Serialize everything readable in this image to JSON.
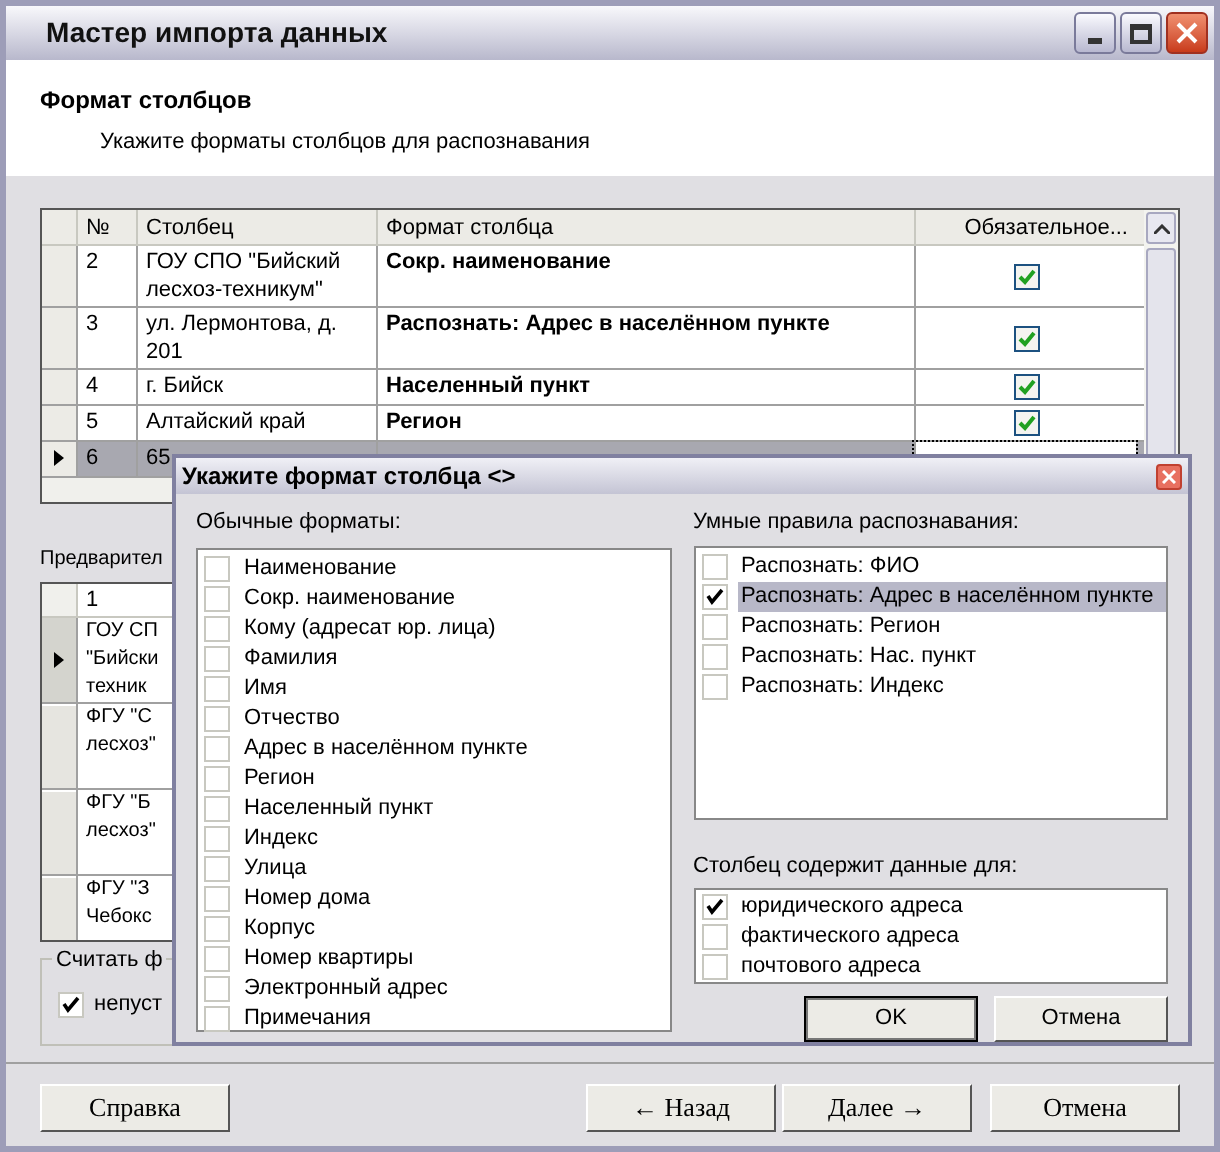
{
  "window": {
    "title": "Мастер импорта данных"
  },
  "header": {
    "title": "Формат столбцов",
    "subtitle": "Укажите форматы столбцов для распознавания"
  },
  "columns_grid": {
    "columns": [
      "№",
      "Столбец",
      "Формат столбца",
      "Обязательное..."
    ],
    "rows": [
      {
        "number": "2",
        "column": "ГОУ СПО \"Бийский лесхоз-техникум\"",
        "format": "Сокр. наименование",
        "required": true,
        "selected": false
      },
      {
        "number": "3",
        "column": "ул. Лермонтова, д. 201",
        "format": "Распознать: Адрес в населённом пункте",
        "required": true,
        "selected": false
      },
      {
        "number": "4",
        "column": "г. Бийск",
        "format": "Населенный пункт",
        "required": true,
        "selected": false
      },
      {
        "number": "5",
        "column": "Алтайский край",
        "format": "Регион",
        "required": true,
        "selected": false
      },
      {
        "number": "6",
        "column": "65",
        "selected": true
      }
    ]
  },
  "preview": {
    "label": "Предварител",
    "columns": [
      "1"
    ],
    "rows": [
      {
        "lines": [
          "ГОУ СП",
          "\"Бийски",
          "техник"
        ],
        "selected": true
      },
      {
        "lines": [
          "ФГУ \"С",
          "лесхоз\""
        ],
        "selected": false
      },
      {
        "lines": [
          "ФГУ \"Б",
          "лесхоз\""
        ],
        "selected": false
      },
      {
        "lines": [
          "ФГУ \"З",
          "Чебокс"
        ],
        "selected": false
      }
    ]
  },
  "count_group": {
    "label": "Считать ф",
    "checkbox": {
      "label": "непуст",
      "checked": true
    }
  },
  "buttons": [
    {
      "label": "Справка",
      "kind": "left"
    },
    {
      "label": "← Назад",
      "kind": "right"
    },
    {
      "label": "Далее →",
      "kind": "right"
    },
    {
      "label": "Отмена",
      "kind": "cancel"
    }
  ],
  "dialog": {
    "title": "Укажите формат столбца <>",
    "standard_label": "Обычные форматы:",
    "standard_formats": [
      {
        "label": "Наименование",
        "checked": false
      },
      {
        "label": "Сокр. наименование",
        "checked": false
      },
      {
        "label": "Кому (адресат юр. лица)",
        "checked": false
      },
      {
        "label": "Фамилия",
        "checked": false
      },
      {
        "label": "Имя",
        "checked": false
      },
      {
        "label": "Отчество",
        "checked": false
      },
      {
        "label": "Адрес в населённом пункте",
        "checked": false
      },
      {
        "label": "Регион",
        "checked": false
      },
      {
        "label": "Населенный пункт",
        "checked": false
      },
      {
        "label": "Индекс",
        "checked": false
      },
      {
        "label": "Улица",
        "checked": false
      },
      {
        "label": "Номер дома",
        "checked": false
      },
      {
        "label": "Корпус",
        "checked": false
      },
      {
        "label": "Номер квартиры",
        "checked": false
      },
      {
        "label": "Электронный адрес",
        "checked": false
      },
      {
        "label": "Примечания",
        "checked": false
      }
    ],
    "smart_label": "Умные правила распознавания:",
    "smart_rules": [
      {
        "label": "Распознать: ФИО",
        "checked": false,
        "selected": false
      },
      {
        "label": "Распознать: Адрес в населённом пункте",
        "checked": true,
        "selected": true
      },
      {
        "label": "Распознать: Регион",
        "checked": false,
        "selected": false
      },
      {
        "label": "Распознать: Нас. пункт",
        "checked": false,
        "selected": false
      },
      {
        "label": "Распознать: Индекс",
        "checked": false,
        "selected": false
      }
    ],
    "usage_label": "Столбец содержит данные для:",
    "usage": [
      {
        "label": "юридического адреса",
        "checked": true
      },
      {
        "label": "фактического адреса",
        "checked": false
      },
      {
        "label": "почтового адреса",
        "checked": false
      }
    ],
    "buttons": [
      {
        "label": "OK",
        "kind": "default"
      },
      {
        "label": "Отмена",
        "kind": "normal"
      }
    ]
  }
}
